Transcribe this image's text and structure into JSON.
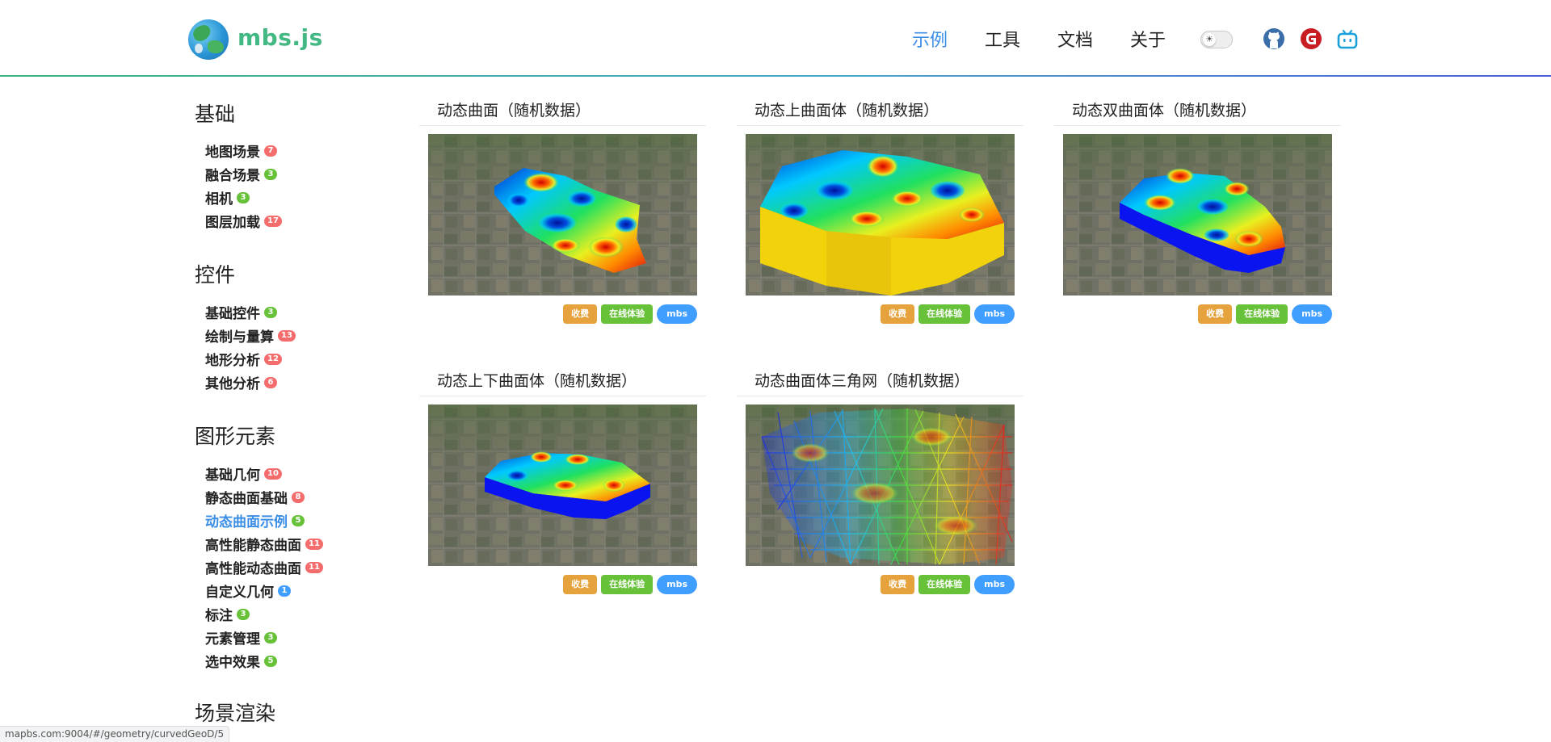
{
  "header": {
    "brand": "mbs.js",
    "nav": [
      {
        "label": "示例",
        "active": true
      },
      {
        "label": "工具",
        "active": false
      },
      {
        "label": "文档",
        "active": false
      },
      {
        "label": "关于",
        "active": false
      }
    ],
    "theme_icon": "sun-icon",
    "social_icons": [
      "github-icon",
      "gitee-icon",
      "bilibili-icon"
    ],
    "accent_color": "#3a8ee6",
    "brand_color": "#42b883"
  },
  "sidebar": {
    "sections": [
      {
        "heading": "基础",
        "items": [
          {
            "label": "地图场景",
            "count": "7",
            "color": "red"
          },
          {
            "label": "融合场景",
            "count": "3",
            "color": "green"
          },
          {
            "label": "相机",
            "count": "3",
            "color": "green"
          },
          {
            "label": "图层加载",
            "count": "17",
            "color": "red"
          }
        ]
      },
      {
        "heading": "控件",
        "items": [
          {
            "label": "基础控件",
            "count": "3",
            "color": "green"
          },
          {
            "label": "绘制与量算",
            "count": "13",
            "color": "red"
          },
          {
            "label": "地形分析",
            "count": "12",
            "color": "red"
          },
          {
            "label": "其他分析",
            "count": "6",
            "color": "red"
          }
        ]
      },
      {
        "heading": "图形元素",
        "items": [
          {
            "label": "基础几何",
            "count": "10",
            "color": "red"
          },
          {
            "label": "静态曲面基础",
            "count": "8",
            "color": "red"
          },
          {
            "label": "动态曲面示例",
            "count": "5",
            "color": "green",
            "active": true
          },
          {
            "label": "高性能静态曲面",
            "count": "11",
            "color": "red"
          },
          {
            "label": "高性能动态曲面",
            "count": "11",
            "color": "red"
          },
          {
            "label": "自定义几何",
            "count": "1",
            "color": "blue"
          },
          {
            "label": "标注",
            "count": "3",
            "color": "green"
          },
          {
            "label": "元素管理",
            "count": "3",
            "color": "green"
          },
          {
            "label": "选中效果",
            "count": "5",
            "color": "green"
          }
        ]
      },
      {
        "heading": "场景渲染",
        "items": []
      }
    ]
  },
  "cards": [
    {
      "title": "动态曲面（随机数据）",
      "thumb": "surface",
      "tags": [
        "收费",
        "在线体验",
        "mbs"
      ]
    },
    {
      "title": "动态上曲面体（随机数据）",
      "thumb": "upper-volume",
      "tags": [
        "收费",
        "在线体验",
        "mbs"
      ]
    },
    {
      "title": "动态双曲面体（随机数据）",
      "thumb": "double-volume",
      "tags": [
        "收费",
        "在线体验",
        "mbs"
      ]
    },
    {
      "title": "动态上下曲面体（随机数据）",
      "thumb": "updown-volume",
      "tags": [
        "收费",
        "在线体验",
        "mbs"
      ]
    },
    {
      "title": "动态曲面体三角网（随机数据）",
      "thumb": "wireframe",
      "tags": [
        "收费",
        "在线体验",
        "mbs"
      ]
    }
  ],
  "status_url": "mapbs.com:9004/#/geometry/curvedGeoD/5"
}
